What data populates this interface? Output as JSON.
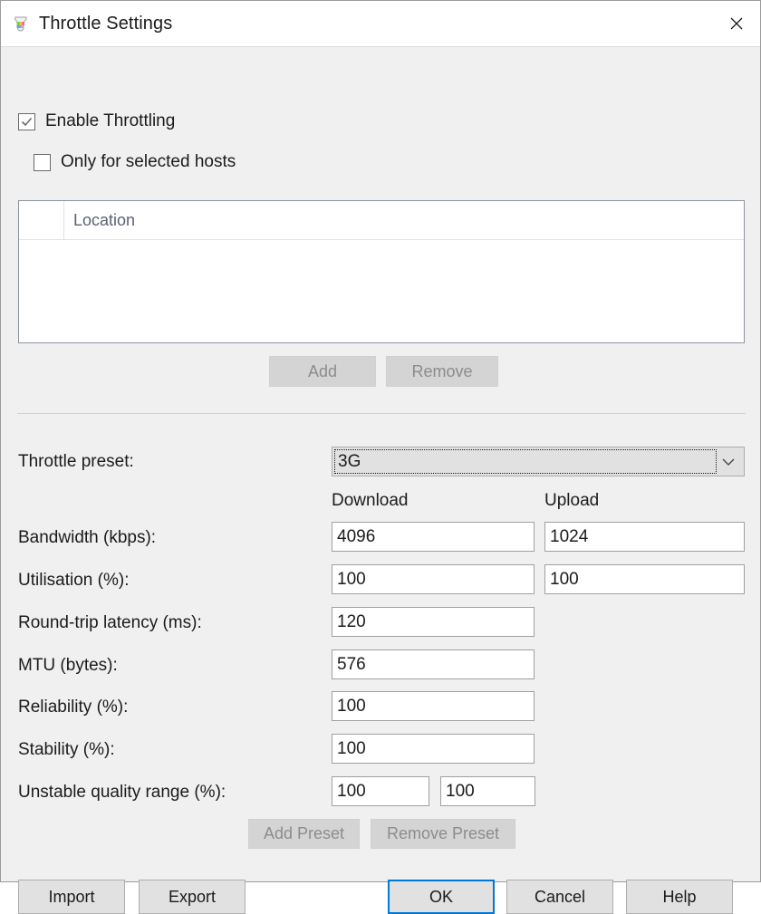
{
  "window": {
    "title": "Throttle Settings",
    "icon": "throttle-app-icon",
    "close_icon": "close-icon"
  },
  "options": {
    "enable_throttling": {
      "label": "Enable Throttling",
      "checked": true
    },
    "only_selected_hosts": {
      "label": "Only for selected hosts",
      "checked": false
    }
  },
  "hosts_list": {
    "columns": [
      "",
      "Location"
    ],
    "rows": []
  },
  "list_buttons": {
    "add": "Add",
    "remove": "Remove"
  },
  "preset": {
    "label": "Throttle preset:",
    "value": "3G",
    "arrow_icon": "chevron-down-icon"
  },
  "columns": {
    "download": "Download",
    "upload": "Upload"
  },
  "fields": {
    "bandwidth": {
      "label": "Bandwidth (kbps):",
      "download": "4096",
      "upload": "1024"
    },
    "utilisation": {
      "label": "Utilisation (%):",
      "download": "100",
      "upload": "100"
    },
    "latency": {
      "label": "Round-trip latency (ms):",
      "download": "120"
    },
    "mtu": {
      "label": "MTU (bytes):",
      "download": "576"
    },
    "reliability": {
      "label": "Reliability (%):",
      "download": "100"
    },
    "stability": {
      "label": "Stability (%):",
      "download": "100"
    },
    "unstable_range": {
      "label": "Unstable quality range (%):",
      "low": "100",
      "high": "100"
    }
  },
  "preset_buttons": {
    "add_preset": "Add Preset",
    "remove_preset": "Remove Preset"
  },
  "dialog_buttons": {
    "import": "Import",
    "export": "Export",
    "ok": "OK",
    "cancel": "Cancel",
    "help": "Help"
  },
  "colors": {
    "accent": "#0078d7",
    "dialog_bg": "#f0f0f0",
    "field_bg": "#ffffff",
    "button_bg": "#e1e1e1",
    "disabled_text": "#8c8c8c"
  }
}
